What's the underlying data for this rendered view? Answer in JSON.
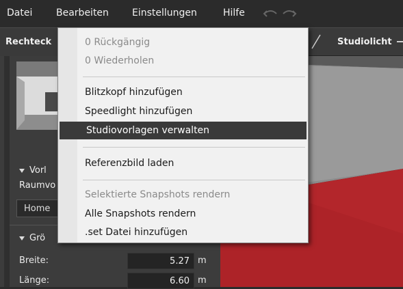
{
  "menubar": {
    "items": [
      "Datei",
      "Bearbeiten",
      "Einstellungen",
      "Hilfe"
    ],
    "undo_icon": "undo-icon",
    "redo_icon": "redo-icon"
  },
  "toolbar": {
    "left_label": "Rechteck",
    "right_label": "Studiolicht"
  },
  "left_panel": {
    "section_presets": "Vorl",
    "room_label": "Raumvo",
    "preset_select_value": "Home",
    "section_size": "Grö",
    "fields": [
      {
        "label": "Breite:",
        "value": "5.27",
        "unit": "m"
      },
      {
        "label": "Länge:",
        "value": "6.60",
        "unit": "m"
      }
    ]
  },
  "menu": {
    "items": [
      {
        "label": "0 Rückgängig",
        "disabled": true
      },
      {
        "label": "0 Wiederholen",
        "disabled": true
      },
      {
        "label": "Blitzkopf hinzufügen",
        "disabled": false
      },
      {
        "label": "Speedlight hinzufügen",
        "disabled": false
      },
      {
        "label": "Studiovorlagen verwalten",
        "disabled": false,
        "highlighted": true
      },
      {
        "label": "Referenzbild laden",
        "disabled": false
      },
      {
        "label": "Selektierte Snapshots rendern",
        "disabled": true
      },
      {
        "label": "Alle Snapshots rendern",
        "disabled": false
      },
      {
        "label": ".set Datei hinzufügen",
        "disabled": false
      }
    ]
  },
  "colors": {
    "menu_bg": "#f1f1f1",
    "highlight": "#3a3a3a",
    "disabled_text": "#8a8a8a",
    "floor_red": "#b3262b"
  }
}
